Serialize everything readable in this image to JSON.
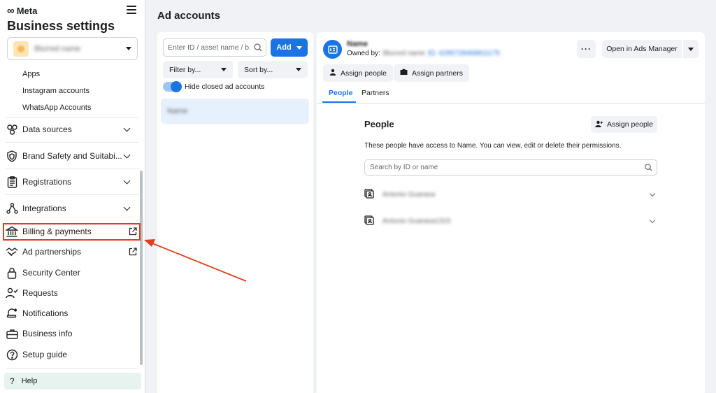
{
  "brand": {
    "logo_text": "Meta"
  },
  "sidebar": {
    "title": "Business settings",
    "business_name": "Blurred name",
    "subitems": [
      {
        "label": "Apps"
      },
      {
        "label": "Instagram accounts"
      },
      {
        "label": "WhatsApp Accounts"
      }
    ],
    "items": [
      {
        "label": "Data sources",
        "icon": "data-sources-icon"
      },
      {
        "label": "Brand Safety and Suitabi...",
        "icon": "shield-icon"
      },
      {
        "label": "Registrations",
        "icon": "clipboard-icon"
      },
      {
        "label": "Integrations",
        "icon": "integrations-icon"
      },
      {
        "label": "Billing & payments",
        "icon": "bank-icon"
      },
      {
        "label": "Ad partnerships",
        "icon": "handshake-icon"
      },
      {
        "label": "Security Center",
        "icon": "lock-icon"
      },
      {
        "label": "Requests",
        "icon": "person-check-icon"
      },
      {
        "label": "Notifications",
        "icon": "bell-icon"
      },
      {
        "label": "Business info",
        "icon": "briefcase-icon"
      },
      {
        "label": "Setup guide",
        "icon": "question-icon"
      }
    ],
    "help_label": "Help",
    "highlight_color": "#e03e1a"
  },
  "ad_accounts": {
    "title": "Ad accounts",
    "search_placeholder": "Enter ID / asset name / b...",
    "add_label": "Add",
    "filter_label": "Filter by...",
    "sort_label": "Sort by...",
    "toggle_label": "Hide closed ad accounts",
    "toggle_on": true,
    "selected_account": "Name"
  },
  "detail": {
    "account_name": "Name",
    "owned_by_label": "Owned by:",
    "owner_name": "Blurred name",
    "owner_id": "ID: 4295728468811175",
    "open_ads_manager_label": "Open in Ads Manager",
    "more_label": "···",
    "assign_people_label": "Assign people",
    "assign_partners_label": "Assign partners",
    "tabs": [
      {
        "label": "People",
        "active": true
      },
      {
        "label": "Partners",
        "active": false
      }
    ],
    "people": {
      "title": "People",
      "assign_label": "Assign people",
      "description": "These people have access to Name. You can view, edit or delete their permissions.",
      "search_placeholder": "Search by ID or name",
      "rows": [
        {
          "name": "Antonio Guarasa"
        },
        {
          "name": "Antonio Guarasa1315"
        }
      ]
    }
  },
  "accent_color": "#1b74e4"
}
